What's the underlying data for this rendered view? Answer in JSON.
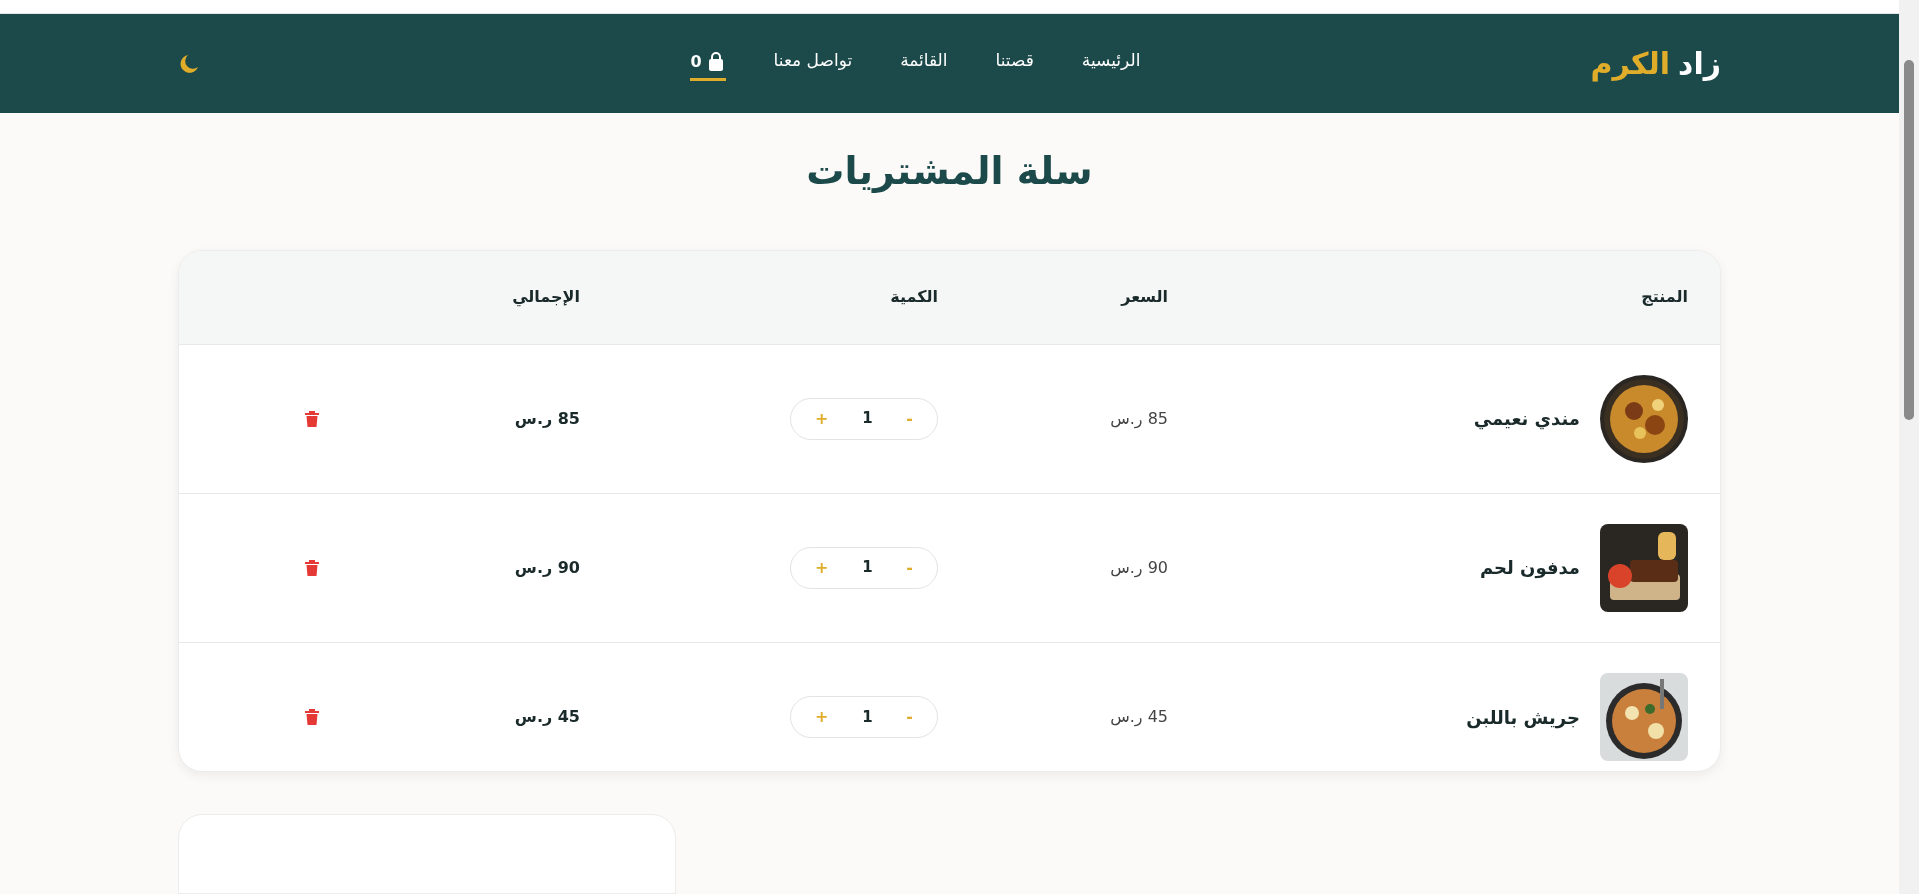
{
  "header": {
    "logo": {
      "first": "زاد",
      "second": "الكرم"
    },
    "nav": [
      {
        "label": "الرئيسية",
        "selected": false
      },
      {
        "label": "قصتنا",
        "selected": false
      },
      {
        "label": "القائمة",
        "selected": false
      },
      {
        "label": "تواصل معنا",
        "selected": false
      }
    ],
    "cart": {
      "count": "0",
      "selected": true
    }
  },
  "title": "سلة المشتريات",
  "table": {
    "columns": [
      "المنتج",
      "السعر",
      "الكمية",
      "الإجمالي"
    ],
    "rows": [
      {
        "name": "مندي نعيمي",
        "price": "85 ر.س",
        "quantity": "1",
        "total": "85 ر.س"
      },
      {
        "name": "مدفون لحم",
        "price": "90 ر.س",
        "quantity": "1",
        "total": "90 ر.س"
      },
      {
        "name": "جريش باللبن",
        "price": "45 ر.س",
        "quantity": "1",
        "total": "45 ر.س"
      }
    ],
    "qty_controls": {
      "minus": "-",
      "plus": "+"
    }
  }
}
